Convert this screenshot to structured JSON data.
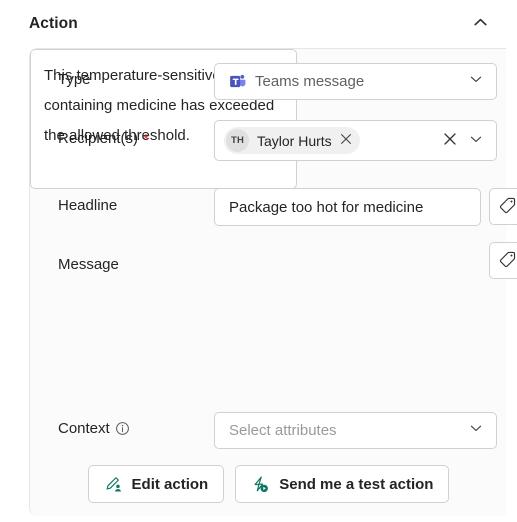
{
  "header": {
    "title": "Action",
    "collapse_icon": "chevron-up-icon"
  },
  "form": {
    "type": {
      "label": "Type",
      "value": "Teams message",
      "icon": "microsoft-teams-icon",
      "chevron": "chevron-down-icon"
    },
    "recipients": {
      "label": "Recipient(s)",
      "required_marker": "*",
      "selected": [
        {
          "initials": "TH",
          "name": "Taylor Hurts",
          "remove_icon": "close-icon"
        }
      ],
      "clear_icon": "close-icon",
      "chevron": "chevron-down-icon"
    },
    "headline": {
      "label": "Headline",
      "value": "Package too hot for medicine",
      "tag_button_icon": "tag-icon"
    },
    "message": {
      "label": "Message",
      "value": "This temperature-sensitive package containing medicine has exceeded the allowed threshold.",
      "tag_button_icon": "tag-icon"
    },
    "context": {
      "label": "Context",
      "info_icon": "info-icon",
      "placeholder": "Select attributes",
      "value": "",
      "chevron": "chevron-down-icon"
    }
  },
  "footer": {
    "edit_action": {
      "label": "Edit action",
      "icon": "edit-person-icon"
    },
    "test_action": {
      "label": "Send me a test action",
      "icon": "flow-play-icon"
    }
  },
  "colors": {
    "accent_teal": "#0f7864",
    "required_red": "#d13438",
    "teams_purple": "#5b5fc7",
    "border": "#d1d1d1",
    "card_bg": "#fbfbfb"
  }
}
